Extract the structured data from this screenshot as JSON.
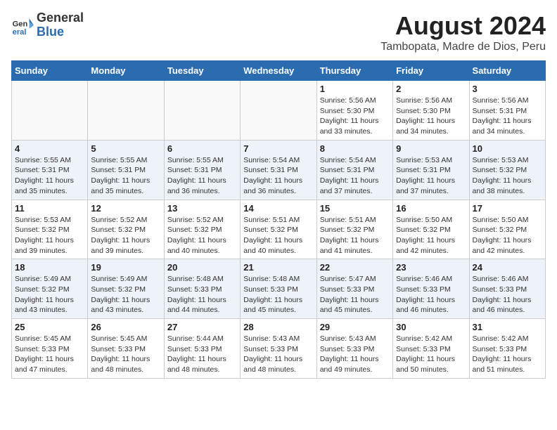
{
  "header": {
    "logo_general": "General",
    "logo_blue": "Blue",
    "title": "August 2024",
    "subtitle": "Tambopata, Madre de Dios, Peru"
  },
  "days_of_week": [
    "Sunday",
    "Monday",
    "Tuesday",
    "Wednesday",
    "Thursday",
    "Friday",
    "Saturday"
  ],
  "weeks": [
    [
      {
        "day": "",
        "info": ""
      },
      {
        "day": "",
        "info": ""
      },
      {
        "day": "",
        "info": ""
      },
      {
        "day": "",
        "info": ""
      },
      {
        "day": "1",
        "info": "Sunrise: 5:56 AM\nSunset: 5:30 PM\nDaylight: 11 hours\nand 33 minutes."
      },
      {
        "day": "2",
        "info": "Sunrise: 5:56 AM\nSunset: 5:30 PM\nDaylight: 11 hours\nand 34 minutes."
      },
      {
        "day": "3",
        "info": "Sunrise: 5:56 AM\nSunset: 5:31 PM\nDaylight: 11 hours\nand 34 minutes."
      }
    ],
    [
      {
        "day": "4",
        "info": "Sunrise: 5:55 AM\nSunset: 5:31 PM\nDaylight: 11 hours\nand 35 minutes."
      },
      {
        "day": "5",
        "info": "Sunrise: 5:55 AM\nSunset: 5:31 PM\nDaylight: 11 hours\nand 35 minutes."
      },
      {
        "day": "6",
        "info": "Sunrise: 5:55 AM\nSunset: 5:31 PM\nDaylight: 11 hours\nand 36 minutes."
      },
      {
        "day": "7",
        "info": "Sunrise: 5:54 AM\nSunset: 5:31 PM\nDaylight: 11 hours\nand 36 minutes."
      },
      {
        "day": "8",
        "info": "Sunrise: 5:54 AM\nSunset: 5:31 PM\nDaylight: 11 hours\nand 37 minutes."
      },
      {
        "day": "9",
        "info": "Sunrise: 5:53 AM\nSunset: 5:31 PM\nDaylight: 11 hours\nand 37 minutes."
      },
      {
        "day": "10",
        "info": "Sunrise: 5:53 AM\nSunset: 5:32 PM\nDaylight: 11 hours\nand 38 minutes."
      }
    ],
    [
      {
        "day": "11",
        "info": "Sunrise: 5:53 AM\nSunset: 5:32 PM\nDaylight: 11 hours\nand 39 minutes."
      },
      {
        "day": "12",
        "info": "Sunrise: 5:52 AM\nSunset: 5:32 PM\nDaylight: 11 hours\nand 39 minutes."
      },
      {
        "day": "13",
        "info": "Sunrise: 5:52 AM\nSunset: 5:32 PM\nDaylight: 11 hours\nand 40 minutes."
      },
      {
        "day": "14",
        "info": "Sunrise: 5:51 AM\nSunset: 5:32 PM\nDaylight: 11 hours\nand 40 minutes."
      },
      {
        "day": "15",
        "info": "Sunrise: 5:51 AM\nSunset: 5:32 PM\nDaylight: 11 hours\nand 41 minutes."
      },
      {
        "day": "16",
        "info": "Sunrise: 5:50 AM\nSunset: 5:32 PM\nDaylight: 11 hours\nand 42 minutes."
      },
      {
        "day": "17",
        "info": "Sunrise: 5:50 AM\nSunset: 5:32 PM\nDaylight: 11 hours\nand 42 minutes."
      }
    ],
    [
      {
        "day": "18",
        "info": "Sunrise: 5:49 AM\nSunset: 5:32 PM\nDaylight: 11 hours\nand 43 minutes."
      },
      {
        "day": "19",
        "info": "Sunrise: 5:49 AM\nSunset: 5:32 PM\nDaylight: 11 hours\nand 43 minutes."
      },
      {
        "day": "20",
        "info": "Sunrise: 5:48 AM\nSunset: 5:33 PM\nDaylight: 11 hours\nand 44 minutes."
      },
      {
        "day": "21",
        "info": "Sunrise: 5:48 AM\nSunset: 5:33 PM\nDaylight: 11 hours\nand 45 minutes."
      },
      {
        "day": "22",
        "info": "Sunrise: 5:47 AM\nSunset: 5:33 PM\nDaylight: 11 hours\nand 45 minutes."
      },
      {
        "day": "23",
        "info": "Sunrise: 5:46 AM\nSunset: 5:33 PM\nDaylight: 11 hours\nand 46 minutes."
      },
      {
        "day": "24",
        "info": "Sunrise: 5:46 AM\nSunset: 5:33 PM\nDaylight: 11 hours\nand 46 minutes."
      }
    ],
    [
      {
        "day": "25",
        "info": "Sunrise: 5:45 AM\nSunset: 5:33 PM\nDaylight: 11 hours\nand 47 minutes."
      },
      {
        "day": "26",
        "info": "Sunrise: 5:45 AM\nSunset: 5:33 PM\nDaylight: 11 hours\nand 48 minutes."
      },
      {
        "day": "27",
        "info": "Sunrise: 5:44 AM\nSunset: 5:33 PM\nDaylight: 11 hours\nand 48 minutes."
      },
      {
        "day": "28",
        "info": "Sunrise: 5:43 AM\nSunset: 5:33 PM\nDaylight: 11 hours\nand 48 minutes."
      },
      {
        "day": "29",
        "info": "Sunrise: 5:43 AM\nSunset: 5:33 PM\nDaylight: 11 hours\nand 49 minutes."
      },
      {
        "day": "30",
        "info": "Sunrise: 5:42 AM\nSunset: 5:33 PM\nDaylight: 11 hours\nand 50 minutes."
      },
      {
        "day": "31",
        "info": "Sunrise: 5:42 AM\nSunset: 5:33 PM\nDaylight: 11 hours\nand 51 minutes."
      }
    ]
  ]
}
